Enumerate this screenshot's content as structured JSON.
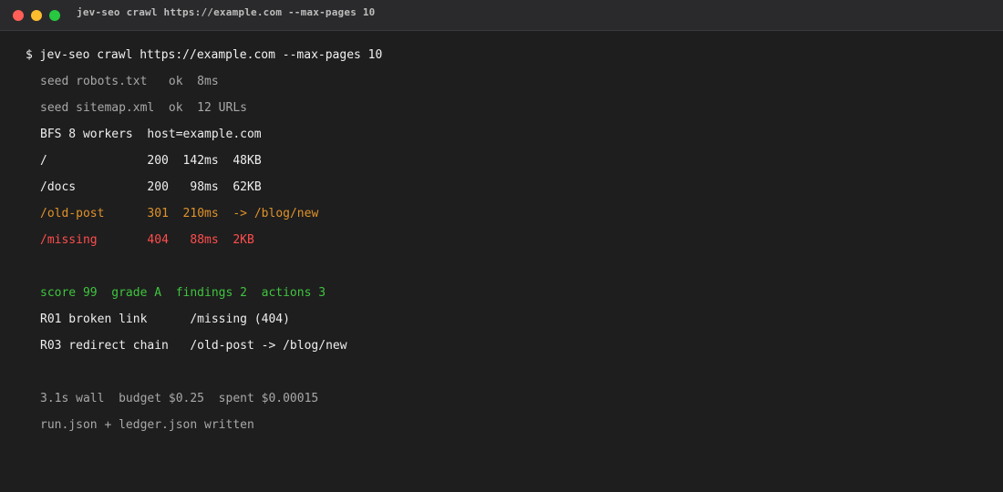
{
  "window": {
    "title": "jev-seo crawl https://example.com --max-pages 10",
    "controls": {
      "close_color": "#ff5f57",
      "minimize_color": "#febc2e",
      "zoom_color": "#28c840"
    }
  },
  "terminal": {
    "prompt": "$ jev-seo crawl https://example.com --max-pages 10",
    "seed_robots": "seed robots.txt   ok  8ms",
    "seed_sitemap": "seed sitemap.xml  ok  12 URLs",
    "bfs": "BFS 8 workers  host=example.com",
    "crawl_rows": [
      {
        "path": "/",
        "padding": "              ",
        "status": "200",
        "timing": "  142ms",
        "detail": "  48KB"
      },
      {
        "path": "/docs",
        "padding": "          ",
        "status": "200",
        "timing": "   98ms",
        "detail": "  62KB"
      },
      {
        "path": "/old-post",
        "padding": "      ",
        "status": "301",
        "timing": "  210ms",
        "detail": "  -> /blog/new"
      },
      {
        "path": "/missing",
        "padding": "       ",
        "status": "404",
        "timing": "   88ms",
        "detail": "  2KB"
      }
    ],
    "summary": "score 99  grade A  findings 2  actions 3",
    "findings": [
      "R01 broken link      /missing (404)",
      "R03 redirect chain   /old-post -> /blog/new"
    ],
    "budget": "3.1s wall  budget $0.25  spent $0.00015",
    "written": "run.json + ledger.json written"
  },
  "colors": {
    "background": "#1e1e1e",
    "redirect": "#e0922b",
    "error": "#ff4d4d",
    "success": "#3fc43f"
  }
}
